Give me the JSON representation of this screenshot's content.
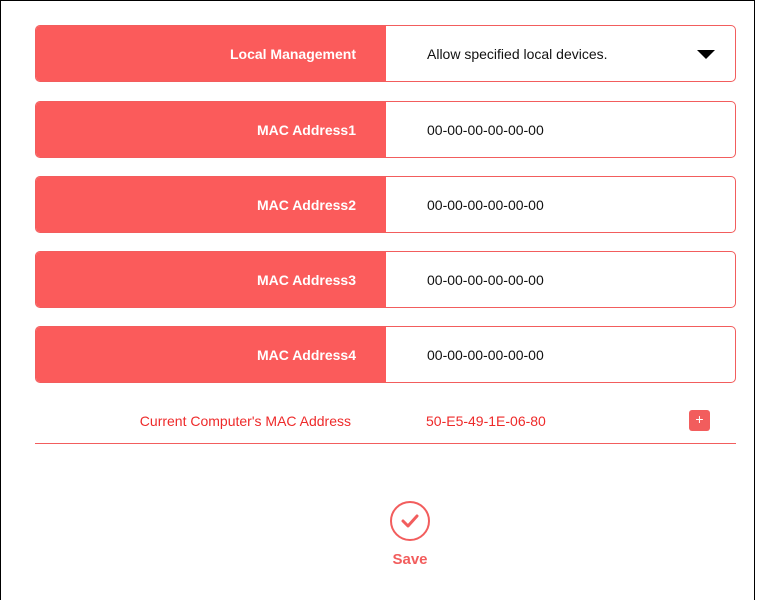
{
  "local_management": {
    "label": "Local Management",
    "selected": "Allow specified local devices."
  },
  "mac_rows": [
    {
      "label": "MAC Address1",
      "value": "00-00-00-00-00-00"
    },
    {
      "label": "MAC Address2",
      "value": "00-00-00-00-00-00"
    },
    {
      "label": "MAC Address3",
      "value": "00-00-00-00-00-00"
    },
    {
      "label": "MAC Address4",
      "value": "00-00-00-00-00-00"
    }
  ],
  "current_mac": {
    "label": "Current Computer's MAC Address",
    "value": "50-E5-49-1E-06-80",
    "add_symbol": "+"
  },
  "save": {
    "label": "Save"
  },
  "colors": {
    "accent": "#fb5b5b",
    "accent_text": "#ee2a2a"
  },
  "icons": {
    "dropdown": "caret-down-icon",
    "save": "check-icon"
  }
}
